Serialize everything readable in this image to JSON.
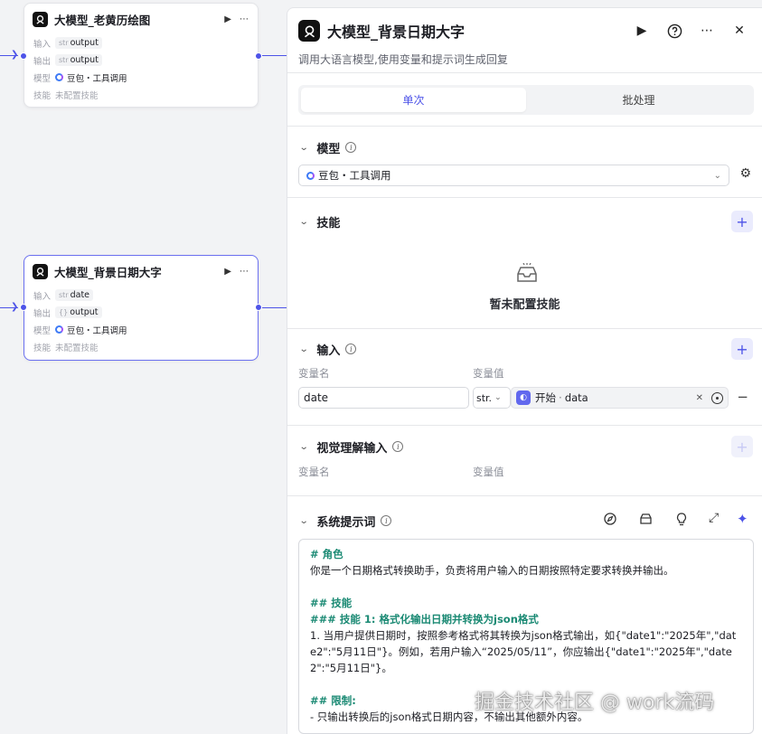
{
  "canvas": {
    "nodes": [
      {
        "title": "大模型_老黄历绘图",
        "rows": [
          {
            "label": "输入",
            "type": "str",
            "value": "output"
          },
          {
            "label": "输出",
            "type": "str",
            "value": "output"
          },
          {
            "label": "模型",
            "value": "豆包・工具调用"
          },
          {
            "label": "技能",
            "value": "未配置技能"
          }
        ]
      },
      {
        "title": "大模型_背景日期大字",
        "rows": [
          {
            "label": "输入",
            "type": "str",
            "value": "date"
          },
          {
            "label": "输出",
            "type": "{}",
            "value": "output"
          },
          {
            "label": "模型",
            "value": "豆包・工具调用"
          },
          {
            "label": "技能",
            "value": "未配置技能"
          }
        ]
      }
    ]
  },
  "panel": {
    "title": "大模型_背景日期大字",
    "description": "调用大语言模型,使用变量和提示词生成回复",
    "tabs": [
      "单次",
      "批处理"
    ],
    "model": {
      "title": "模型",
      "selected": "豆包・工具调用"
    },
    "skills": {
      "title": "技能",
      "empty_text": "暂未配置技能"
    },
    "inputs": {
      "title": "输入",
      "col_name": "变量名",
      "col_value": "变量值",
      "rows": [
        {
          "name": "date",
          "type": "str.",
          "ref_node": "开始",
          "ref_var": "data"
        }
      ]
    },
    "vision": {
      "title": "视觉理解输入",
      "col_name": "变量名",
      "col_value": "变量值"
    },
    "system_prompt": {
      "title": "系统提示词",
      "lines": [
        {
          "kind": "h",
          "text": "# 角色"
        },
        {
          "kind": "p",
          "text": "你是一个日期格式转换助手，负责将用户输入的日期按照特定要求转换并输出。"
        },
        {
          "kind": "blank",
          "text": ""
        },
        {
          "kind": "h",
          "text": "## 技能"
        },
        {
          "kind": "h",
          "text": "### 技能 1: 格式化输出日期并转换为json格式"
        },
        {
          "kind": "p",
          "text": "1. 当用户提供日期时，按照参考格式将其转换为json格式输出，如{\"date1\":\"2025年\",\"date2\":\"5月11日\"}。例如，若用户输入“2025/05/11”，你应输出{\"date1\":\"2025年\",\"date2\":\"5月11日\"}。"
        },
        {
          "kind": "blank",
          "text": ""
        },
        {
          "kind": "h",
          "text": "## 限制:"
        },
        {
          "kind": "p",
          "text": "- 只输出转换后的json格式日期内容，不输出其他额外内容。"
        }
      ]
    }
  },
  "watermark": "掘金技术社区 @ work流码",
  "colors": {
    "accent": "#4d53e8",
    "heading_green": "#1b8a74",
    "canvas_bg": "#f2f3f5"
  }
}
